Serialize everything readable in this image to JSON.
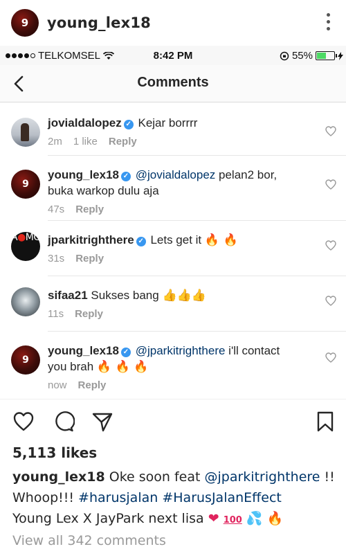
{
  "post": {
    "username": "young_lex18",
    "avatar_text": "9"
  },
  "status_bar": {
    "carrier": "TELKOMSEL",
    "time": "8:42 PM",
    "battery": "55%",
    "battery_level": 0.55
  },
  "nav": {
    "title": "Comments"
  },
  "comments": [
    {
      "username": "jovialdalopez",
      "verified": true,
      "text": "Kejar borrrr",
      "time": "2m",
      "likes": "1 like",
      "reply": "Reply"
    },
    {
      "username": "young_lex18",
      "verified": true,
      "mention": "@jovialdalopez",
      "text": "pelan2 bor,",
      "text2": "buka warkop dulu aja",
      "time": "47s",
      "reply": "Reply"
    },
    {
      "username": "jparkitrighthere",
      "verified": true,
      "text": "Lets get it",
      "emoji": "🔥 🔥",
      "time": "31s",
      "reply": "Reply",
      "avatar_text_a": "A",
      "avatar_text_b": "MG"
    },
    {
      "username": "sifaa21",
      "verified": false,
      "text": "Sukses bang",
      "emoji": "👍👍👍",
      "time": "11s",
      "reply": "Reply"
    },
    {
      "username": "young_lex18",
      "verified": true,
      "mention": "@jparkitrighthere",
      "text": "i'll contact",
      "text2": "you brah",
      "emoji": "🔥 🔥 🔥",
      "time": "now",
      "reply": "Reply"
    }
  ],
  "likes": "5,113 likes",
  "caption": {
    "username": "young_lex18",
    "text1": "Oke soon feat",
    "mention": "@jparkitrighthere",
    "text2": "!!",
    "text3": "Whoop!!!",
    "tag1": "#harusjalan",
    "tag2": "#HarusJalanEffect",
    "text4": "Young Lex X JayPark next lisa",
    "emoji_heart": "❤",
    "emoji_100": "100",
    "emoji_sweat": "💦",
    "emoji_fire": "🔥"
  },
  "view_all": "View all 342 comments",
  "colors": {
    "link": "#003569",
    "verified": "#3897f0",
    "muted": "#999999",
    "battery": "#4cd964"
  }
}
